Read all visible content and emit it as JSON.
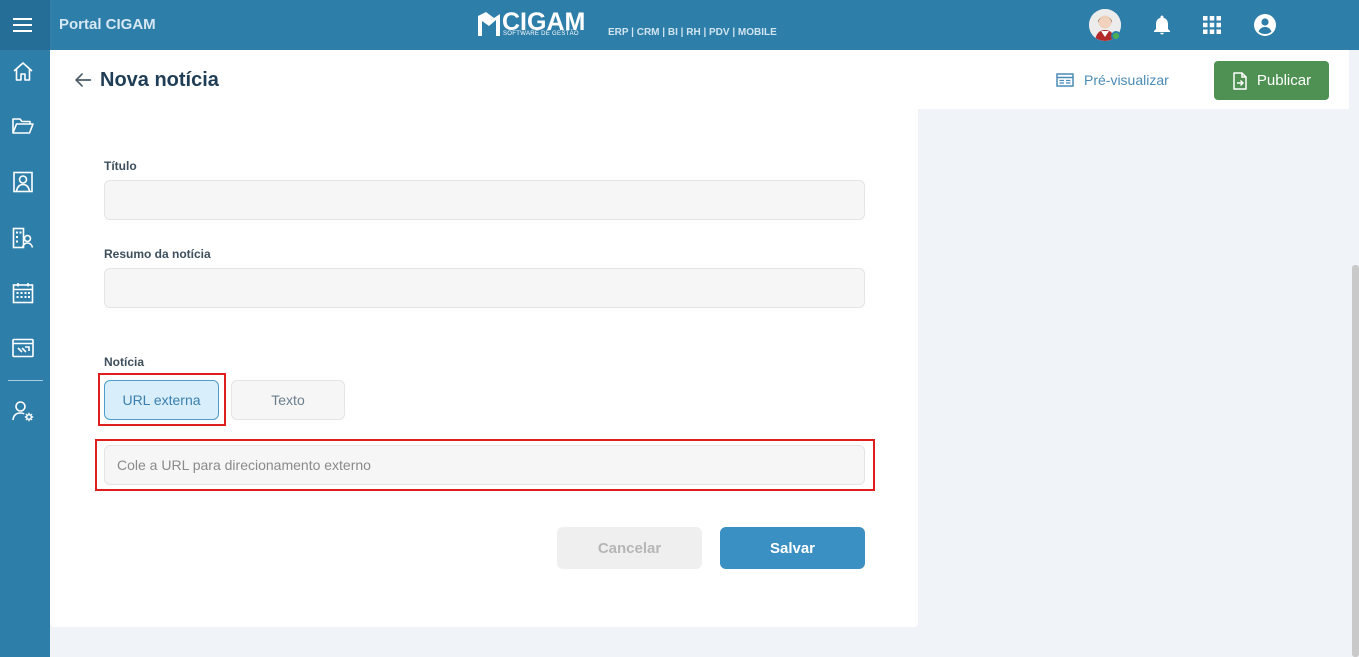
{
  "topbar": {
    "portal_title": "Portal CIGAM",
    "logo_text": "CIGAM",
    "logo_subtitle": "SOFTWARE DE GESTÃO",
    "modules": "ERP | CRM | BI | RH | PDV | MOBILE"
  },
  "header": {
    "title": "Nova notícia",
    "preview_label": "Pré-visualizar",
    "publish_label": "Publicar"
  },
  "form": {
    "title_label": "Título",
    "title_value": "",
    "summary_label": "Resumo da notícia",
    "summary_value": "",
    "news_label": "Notícia",
    "toggle_url_label": "URL externa",
    "toggle_text_label": "Texto",
    "url_placeholder": "Cole a URL para direcionamento externo",
    "cancel_label": "Cancelar",
    "save_label": "Salvar"
  },
  "sidebar": {
    "icons": [
      "home-icon",
      "folder-icon",
      "contacts-icon",
      "org-people-icon",
      "calendar-icon",
      "tickets-icon",
      "user-settings-icon"
    ]
  },
  "colors": {
    "brand_blue": "#2e7eaa",
    "publish_green": "#4e9152",
    "save_blue": "#3a8fc3",
    "highlight_red": "#e01e1e"
  }
}
